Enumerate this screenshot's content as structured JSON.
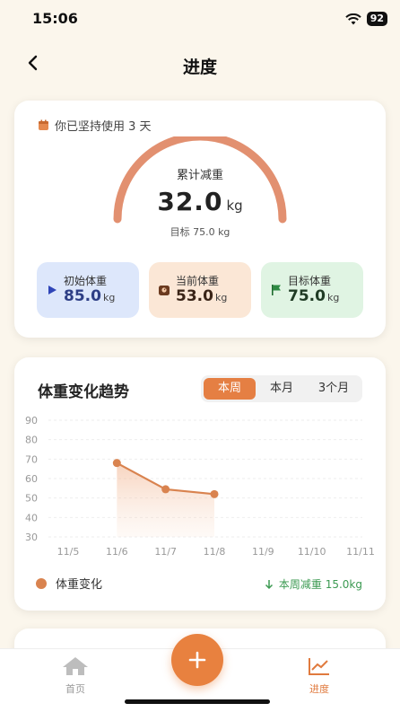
{
  "status_bar": {
    "time": "15:06",
    "battery": "92"
  },
  "nav": {
    "title": "进度"
  },
  "summary": {
    "streak_text": "你已坚持使用 3 天",
    "gauge_caption": "累计减重",
    "total_lost": "32.0",
    "unit": "kg",
    "target_text": "目标 75.0 kg",
    "stats": {
      "initial": {
        "label": "初始体重",
        "value": "85.0",
        "unit": "kg"
      },
      "current": {
        "label": "当前体重",
        "value": "53.0",
        "unit": "kg"
      },
      "target": {
        "label": "目标体重",
        "value": "75.0",
        "unit": "kg"
      }
    }
  },
  "trend": {
    "title": "体重变化趋势",
    "periods": [
      "本周",
      "本月",
      "3个月"
    ],
    "active_period": "本周",
    "legend": "体重变化",
    "weekly_loss": "本周减重 15.0kg"
  },
  "chart_data": {
    "type": "area",
    "x": [
      "11/5",
      "11/6",
      "11/7",
      "11/8",
      "11/9",
      "11/10",
      "11/11"
    ],
    "y_ticks": [
      90,
      80,
      70,
      60,
      50,
      40,
      30
    ],
    "ylim": [
      30,
      90
    ],
    "series": [
      {
        "name": "体重变化",
        "points": [
          [
            "11/6",
            68
          ],
          [
            "11/7",
            54.5
          ],
          [
            "11/8",
            52
          ]
        ]
      }
    ],
    "grid": true,
    "color": "#d9834f"
  },
  "tabs": {
    "home": "首页",
    "progress": "进度"
  },
  "colors": {
    "accent": "#e8813f",
    "green": "#3c9a52"
  }
}
